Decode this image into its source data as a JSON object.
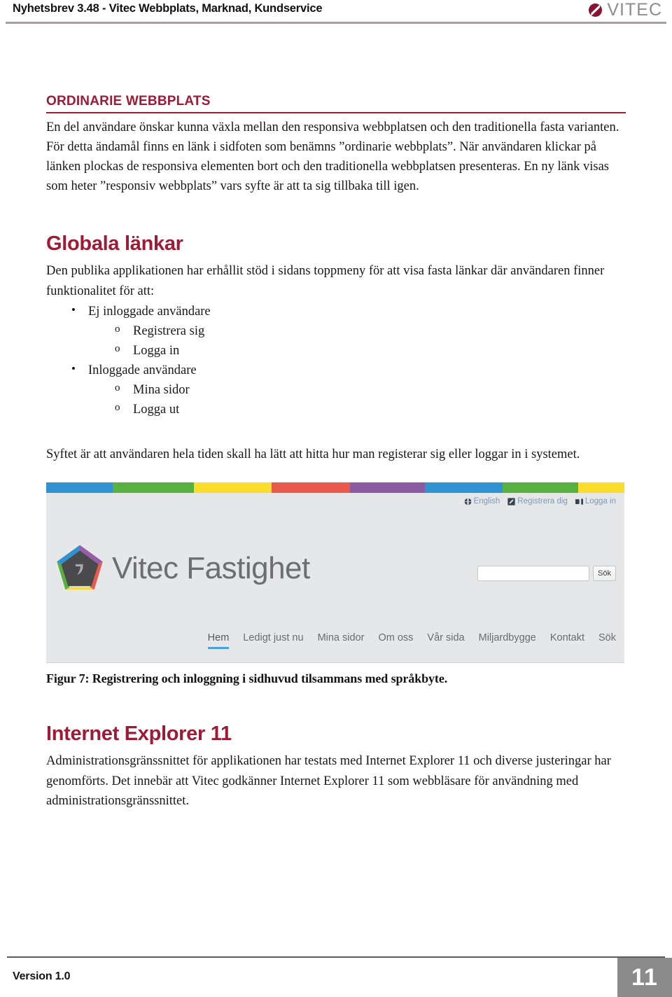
{
  "header": {
    "title": "Nyhetsbrev 3.48 - Vitec Webbplats, Marknad, Kundservice",
    "logo_text": "VITEC",
    "accent_color": "#9d1b34",
    "rule_color": "#a99da4"
  },
  "sections": {
    "ordinarie": {
      "heading": "ORDINARIE WEBBPLATS",
      "paragraph": "En del användare önskar kunna växla mellan den responsiva webbplatsen och den traditionella fasta varianten. För detta ändamål finns en länk i sidfoten som benämns ”ordinarie webbplats”. När användaren klickar på länken plockas de responsiva elementen bort och den traditionella webbplatsen presenteras. En ny länk visas som heter ”responsiv webbplats” vars syfte är att ta sig tillbaka till igen."
    },
    "globala": {
      "heading": "Globala länkar",
      "paragraph": "Den publika applikationen har erhållit stöd i sidans toppmeny för att visa fasta länkar där användaren finner funktionalitet för att:",
      "list": [
        {
          "label": "Ej inloggade användare",
          "children": [
            "Registrera sig",
            "Logga in"
          ]
        },
        {
          "label": "Inloggade användare",
          "children": [
            "Mina sidor",
            "Logga ut"
          ]
        }
      ],
      "closing_paragraph": "Syftet är att användaren hela tiden skall ha lätt att hitta hur man registerar sig eller loggar in i systemet."
    },
    "ie11": {
      "heading": "Internet Explorer 11",
      "paragraph": "Administrationsgränssnittet för applikationen har testats med Internet Explorer 11 och diverse justeringar har genomförts. Det innebär att Vitec godkänner Internet Explorer 11 som webbläsare för användning med administrationsgränssnittet."
    }
  },
  "figure": {
    "caption": "Figur 7: Registrering och inloggning i sidhuvud tilsammans med språkbyte.",
    "screenshot": {
      "colorbar": [
        {
          "color": "#2f93d1",
          "width": 11.5
        },
        {
          "color": "#57b040",
          "width": 14.0
        },
        {
          "color": "#fbdd2c",
          "width": 13.5
        },
        {
          "color": "#e9594c",
          "width": 13.5
        },
        {
          "color": "#8a5ba0",
          "width": 13.0
        },
        {
          "color": "#2f93d1",
          "width": 13.5
        },
        {
          "color": "#57b040",
          "width": 13.0
        },
        {
          "color": "#fbdd2c",
          "width": 8.0
        }
      ],
      "top_links": [
        {
          "icon": "globe-icon",
          "label": "English"
        },
        {
          "icon": "pencil-icon",
          "label": "Registrera dig"
        },
        {
          "icon": "sign-in-icon",
          "label": "Logga in"
        }
      ],
      "brand": {
        "logo": "vitec-pentagon-logo",
        "name": "Vitec Fastighet"
      },
      "search": {
        "value": "",
        "placeholder": "",
        "button_label": "Sök"
      },
      "nav": [
        {
          "label": "Hem",
          "active": true
        },
        {
          "label": "Ledigt just nu",
          "active": false
        },
        {
          "label": "Mina sidor",
          "active": false
        },
        {
          "label": "Om oss",
          "active": false
        },
        {
          "label": "Vår sida",
          "active": false
        },
        {
          "label": "Miljardbygge",
          "active": false
        },
        {
          "label": "Kontakt",
          "active": false
        },
        {
          "label": "Sök",
          "active": false
        }
      ],
      "active_underline_color": "#4a9fd8"
    }
  },
  "footer": {
    "version": "Version 1.0",
    "page_number": "11"
  }
}
